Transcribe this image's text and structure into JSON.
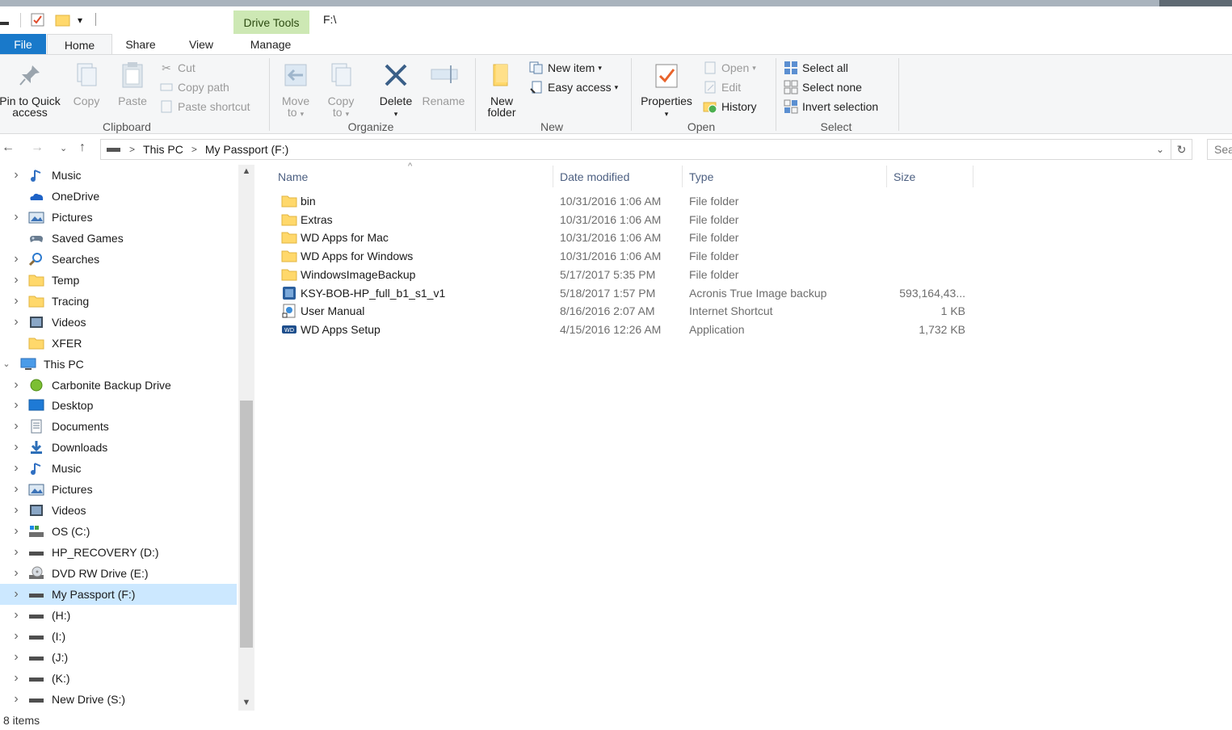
{
  "window": {
    "contextual_tab": "Drive Tools",
    "title_path": "F:\\"
  },
  "tabs": {
    "file": "File",
    "home": "Home",
    "share": "Share",
    "view": "View",
    "manage": "Manage"
  },
  "ribbon": {
    "clipboard": {
      "label": "Clipboard",
      "pin_l1": "Pin to Quick",
      "pin_l2": "access",
      "copy": "Copy",
      "paste": "Paste",
      "cut": "Cut",
      "copy_path": "Copy path",
      "paste_shortcut": "Paste shortcut"
    },
    "organize": {
      "label": "Organize",
      "move_l1": "Move",
      "move_l2": "to",
      "copy_l1": "Copy",
      "copy_l2": "to",
      "delete": "Delete",
      "rename": "Rename"
    },
    "new": {
      "label": "New",
      "new_folder_l1": "New",
      "new_folder_l2": "folder",
      "new_item": "New item",
      "easy_access": "Easy access"
    },
    "open": {
      "label": "Open",
      "properties": "Properties",
      "open": "Open",
      "edit": "Edit",
      "history": "History"
    },
    "select": {
      "label": "Select",
      "select_all": "Select all",
      "select_none": "Select none",
      "invert": "Invert selection"
    }
  },
  "address": {
    "crumbs": [
      "This PC",
      "My Passport (F:)"
    ],
    "search_placeholder": "Sea"
  },
  "nav": {
    "items": [
      {
        "label": "Music",
        "icon": "music-icon",
        "chev": ">",
        "indent": 1
      },
      {
        "label": "OneDrive",
        "icon": "onedrive-icon",
        "chev": "",
        "indent": 1
      },
      {
        "label": "Pictures",
        "icon": "pictures-icon",
        "chev": ">",
        "indent": 1
      },
      {
        "label": "Saved Games",
        "icon": "saved-games-icon",
        "chev": "",
        "indent": 1
      },
      {
        "label": "Searches",
        "icon": "searches-icon",
        "chev": ">",
        "indent": 1
      },
      {
        "label": "Temp",
        "icon": "folder-icon",
        "chev": ">",
        "indent": 1
      },
      {
        "label": "Tracing",
        "icon": "folder-icon",
        "chev": ">",
        "indent": 1
      },
      {
        "label": "Videos",
        "icon": "videos-icon",
        "chev": ">",
        "indent": 1
      },
      {
        "label": "XFER",
        "icon": "folder-icon",
        "chev": "",
        "indent": 1
      },
      {
        "label": "This PC",
        "icon": "this-pc-icon",
        "chev": "v",
        "indent": 0
      },
      {
        "label": "Carbonite Backup Drive",
        "icon": "carbonite-icon",
        "chev": ">",
        "indent": 1
      },
      {
        "label": "Desktop",
        "icon": "desktop-icon",
        "chev": ">",
        "indent": 1
      },
      {
        "label": "Documents",
        "icon": "documents-icon",
        "chev": ">",
        "indent": 1
      },
      {
        "label": "Downloads",
        "icon": "downloads-icon",
        "chev": ">",
        "indent": 1
      },
      {
        "label": "Music",
        "icon": "music-icon",
        "chev": ">",
        "indent": 1
      },
      {
        "label": "Pictures",
        "icon": "pictures-icon",
        "chev": ">",
        "indent": 1
      },
      {
        "label": "Videos",
        "icon": "videos-icon",
        "chev": ">",
        "indent": 1
      },
      {
        "label": "OS (C:)",
        "icon": "os-drive-icon",
        "chev": ">",
        "indent": 1
      },
      {
        "label": "HP_RECOVERY (D:)",
        "icon": "drive-icon",
        "chev": ">",
        "indent": 1
      },
      {
        "label": "DVD RW Drive (E:)",
        "icon": "dvd-icon",
        "chev": ">",
        "indent": 1
      },
      {
        "label": "My Passport (F:)",
        "icon": "drive-icon",
        "chev": ">",
        "indent": 1,
        "selected": true
      },
      {
        "label": "(H:)",
        "icon": "drive-icon",
        "chev": ">",
        "indent": 1
      },
      {
        "label": "(I:)",
        "icon": "drive-icon",
        "chev": ">",
        "indent": 1
      },
      {
        "label": "(J:)",
        "icon": "drive-icon",
        "chev": ">",
        "indent": 1
      },
      {
        "label": "(K:)",
        "icon": "drive-icon",
        "chev": ">",
        "indent": 1
      },
      {
        "label": "New Drive (S:)",
        "icon": "drive-icon",
        "chev": ">",
        "indent": 1
      }
    ]
  },
  "columns": {
    "name": "Name",
    "date": "Date modified",
    "type": "Type",
    "size": "Size"
  },
  "files": [
    {
      "name": "bin",
      "date": "10/31/2016 1:06 AM",
      "type": "File folder",
      "size": "",
      "icon": "folder-icon"
    },
    {
      "name": "Extras",
      "date": "10/31/2016 1:06 AM",
      "type": "File folder",
      "size": "",
      "icon": "folder-icon"
    },
    {
      "name": "WD Apps for Mac",
      "date": "10/31/2016 1:06 AM",
      "type": "File folder",
      "size": "",
      "icon": "folder-icon"
    },
    {
      "name": "WD Apps for Windows",
      "date": "10/31/2016 1:06 AM",
      "type": "File folder",
      "size": "",
      "icon": "folder-icon"
    },
    {
      "name": "WindowsImageBackup",
      "date": "5/17/2017 5:35 PM",
      "type": "File folder",
      "size": "",
      "icon": "folder-icon"
    },
    {
      "name": "KSY-BOB-HP_full_b1_s1_v1",
      "date": "5/18/2017 1:57 PM",
      "type": "Acronis True Image backup",
      "size": "593,164,43...",
      "icon": "acronis-icon"
    },
    {
      "name": "User Manual",
      "date": "8/16/2016 2:07 AM",
      "type": "Internet Shortcut",
      "size": "1 KB",
      "icon": "shortcut-icon"
    },
    {
      "name": "WD Apps Setup",
      "date": "4/15/2016 12:26 AM",
      "type": "Application",
      "size": "1,732 KB",
      "icon": "wd-app-icon"
    }
  ],
  "status": {
    "count": "8 items"
  }
}
